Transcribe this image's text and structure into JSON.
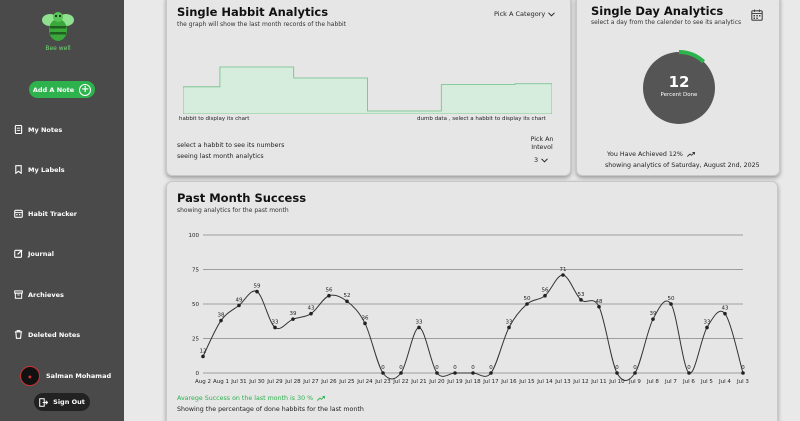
{
  "sidebar": {
    "logo_text": "Bee well",
    "add_note_label": "Add A Note",
    "items": [
      {
        "label": "My Notes"
      },
      {
        "label": "My Labels"
      },
      {
        "label": "Habit Tracker"
      },
      {
        "label": "Journal"
      },
      {
        "label": "Archieves"
      },
      {
        "label": "Deleted Notes"
      }
    ],
    "user_name": "Salman Mohamad",
    "sign_out_label": "Sign Out"
  },
  "single_habit": {
    "title": "Single Habbit Analytics",
    "subtitle": "the graph will show the last month records of the habbit",
    "category_dropdown": "Pick A Category",
    "caption_left": "habbit to display its chart",
    "caption_right": "dumb data , select a habbit to display its chart",
    "select_prompt": "select a habbit to see its numbers",
    "seeing_text": "seeing last month analytics",
    "interval_label": "Pick An Intevol",
    "interval_value": "3",
    "chart_data": {
      "type": "area",
      "step": true,
      "values": [
        0.55,
        1.0,
        1.0,
        0.75,
        0.75,
        0.0,
        0.0,
        0.6,
        0.6,
        0.62
      ],
      "color": "#6dbf86"
    }
  },
  "single_day": {
    "title": "Single Day Analytics",
    "subtitle": "select a day from the calender to see its analytics",
    "percent_value": "12",
    "percent_label": "Percent Done",
    "percent_fraction": 0.12,
    "achieved_text": "You Have Achieved 12%",
    "showing_text": "showing analytics of Saturday, August 2nd, 2025",
    "accent": "#2db24d"
  },
  "past_month": {
    "title": "Past Month Success",
    "subtitle": "showing analytics for the past month",
    "average_text": "Avarege Success on the last month is 30 %",
    "footer_text": "Showing the percentage of done habbits for the last month",
    "chart_data": {
      "type": "line",
      "ylim": [
        0,
        100
      ],
      "yticks": [
        0,
        25,
        50,
        75,
        100
      ],
      "x": [
        "Aug 2",
        "Aug 1",
        "Jul 31",
        "Jul 30",
        "Jul 29",
        "Jul 28",
        "Jul 27",
        "Jul 26",
        "Jul 25",
        "Jul 24",
        "Jul 23",
        "Jul 22",
        "Jul 21",
        "Jul 20",
        "Jul 19",
        "Jul 18",
        "Jul 17",
        "Jul 16",
        "Jul 15",
        "Jul 14",
        "Jul 13",
        "Jul 12",
        "Jul 11",
        "Jul 10",
        "Jul 9",
        "Jul 8",
        "Jul 7",
        "Jul 6",
        "Jul 5",
        "Jul 4",
        "Jul 3"
      ],
      "values": [
        12,
        38,
        49,
        59,
        33,
        39,
        43,
        56,
        52,
        36,
        0,
        0,
        33,
        0,
        0,
        0,
        0,
        33,
        50,
        56,
        71,
        53,
        48,
        0,
        0,
        39,
        50,
        0,
        33,
        43,
        0
      ],
      "color": "#333333"
    }
  }
}
